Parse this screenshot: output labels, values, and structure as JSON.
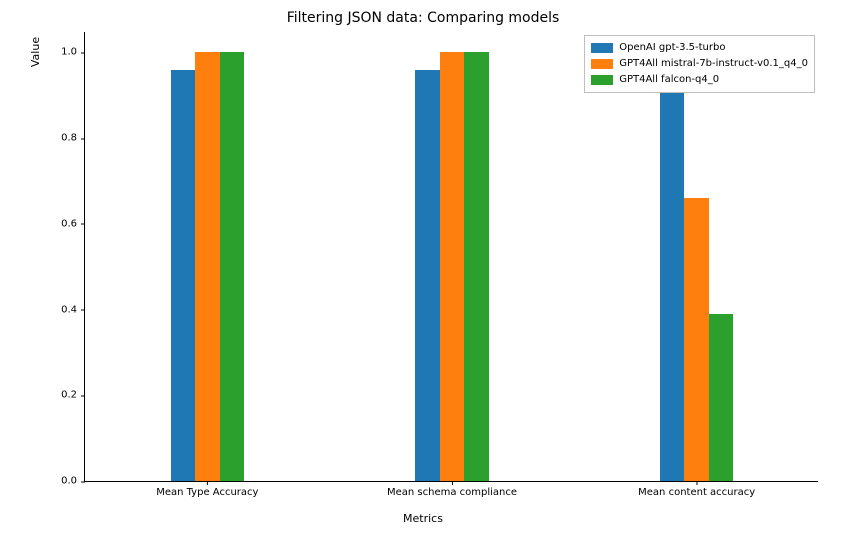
{
  "chart_data": {
    "type": "bar",
    "title": "Filtering JSON data: Comparing models",
    "xlabel": "Metrics",
    "ylabel": "Value",
    "ylim": [
      0.0,
      1.05
    ],
    "yticks": [
      0.0,
      0.2,
      0.4,
      0.6,
      0.8,
      1.0
    ],
    "ytick_labels": [
      "0.0",
      "0.2",
      "0.4",
      "0.6",
      "0.8",
      "1.0"
    ],
    "categories": [
      "Mean Type Accuracy",
      "Mean schema compliance",
      "Mean content accuracy"
    ],
    "series": [
      {
        "name": "OpenAI gpt-3.5-turbo",
        "color": "#1f77b4",
        "values": [
          0.96,
          0.96,
          1.0
        ]
      },
      {
        "name": "GPT4All mistral-7b-instruct-v0.1_q4_0",
        "color": "#ff7f0e",
        "values": [
          1.0,
          1.0,
          0.66
        ]
      },
      {
        "name": "GPT4All falcon-q4_0",
        "color": "#2ca02c",
        "values": [
          1.0,
          1.0,
          0.39
        ]
      }
    ],
    "legend_position": "upper right"
  }
}
